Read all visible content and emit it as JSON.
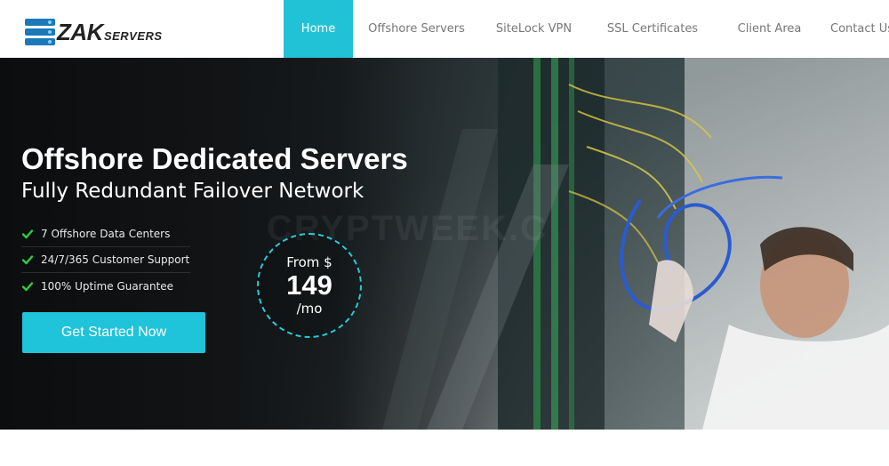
{
  "brand": {
    "logo_main": "ZAK",
    "logo_sub": "SERVERS",
    "accent_color": "#22c2d6"
  },
  "nav": {
    "items": [
      {
        "label": "Home",
        "active": true
      },
      {
        "label": "Offshore Servers",
        "active": false
      },
      {
        "label": "SiteLock VPN",
        "active": false
      },
      {
        "label": "SSL Certificates",
        "active": false
      },
      {
        "label": "Client Area",
        "active": false
      },
      {
        "label": "Contact Us",
        "active": false
      }
    ]
  },
  "hero": {
    "title": "Offshore Dedicated Servers",
    "subtitle": "Fully Redundant Failover Network",
    "features": [
      {
        "icon": "check-icon",
        "text": "7 Offshore Data Centers"
      },
      {
        "icon": "check-icon",
        "text": "24/7/365 Customer Support"
      },
      {
        "icon": "check-icon",
        "text": "100% Uptime Guarantee"
      }
    ],
    "cta_label": "Get Started Now",
    "price": {
      "from": "From $",
      "amount": "149",
      "period": "/mo"
    },
    "watermark": "CRYPTWEEK.C"
  }
}
